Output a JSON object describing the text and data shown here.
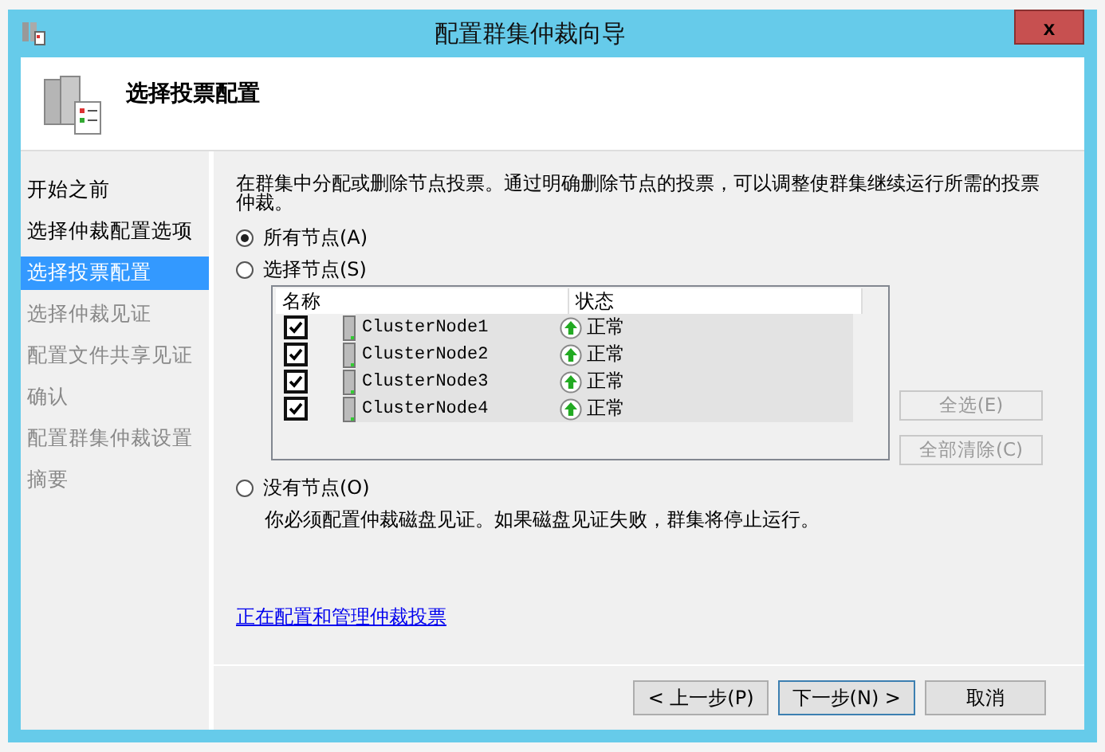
{
  "window": {
    "title": "配置群集仲裁向导",
    "close": "x"
  },
  "header": {
    "title": "选择投票配置"
  },
  "sidebar": {
    "items": [
      {
        "label": "开始之前",
        "selected": false,
        "disabled": false
      },
      {
        "label": "选择仲裁配置选项",
        "selected": false,
        "disabled": false
      },
      {
        "label": "选择投票配置",
        "selected": true,
        "disabled": false
      },
      {
        "label": "选择仲裁见证",
        "selected": false,
        "disabled": true
      },
      {
        "label": "配置文件共享见证",
        "selected": false,
        "disabled": true
      },
      {
        "label": "确认",
        "selected": false,
        "disabled": true
      },
      {
        "label": "配置群集仲裁设置",
        "selected": false,
        "disabled": true
      },
      {
        "label": "摘要",
        "selected": false,
        "disabled": true
      }
    ]
  },
  "intro": "在群集中分配或删除节点投票。通过明确删除节点的投票，可以调整使群集继续运行所需的投票仲裁。",
  "options": [
    {
      "label": "所有节点(A)",
      "selected": true
    },
    {
      "label": "选择节点(S)",
      "selected": false
    },
    {
      "label": "没有节点(O)",
      "selected": false
    }
  ],
  "table": {
    "columns": [
      "名称",
      "状态"
    ],
    "rows": [
      {
        "checked": true,
        "name": "ClusterNode1",
        "status": "正常"
      },
      {
        "checked": true,
        "name": "ClusterNode2",
        "status": "正常"
      },
      {
        "checked": true,
        "name": "ClusterNode3",
        "status": "正常"
      },
      {
        "checked": true,
        "name": "ClusterNode4",
        "status": "正常"
      }
    ]
  },
  "side_buttons": [
    {
      "label": "全选(E)",
      "disabled": true
    },
    {
      "label": "全部清除(C)",
      "disabled": true
    }
  ],
  "no_nodes_note": "你必须配置仲裁磁盘见证。如果磁盘见证失败，群集将停止运行。",
  "link": "正在配置和管理仲裁投票",
  "buttons": [
    {
      "label": "< 上一步(P)",
      "default": false
    },
    {
      "label": "下一步(N) >",
      "default": true
    },
    {
      "label": "取消",
      "default": false
    }
  ]
}
